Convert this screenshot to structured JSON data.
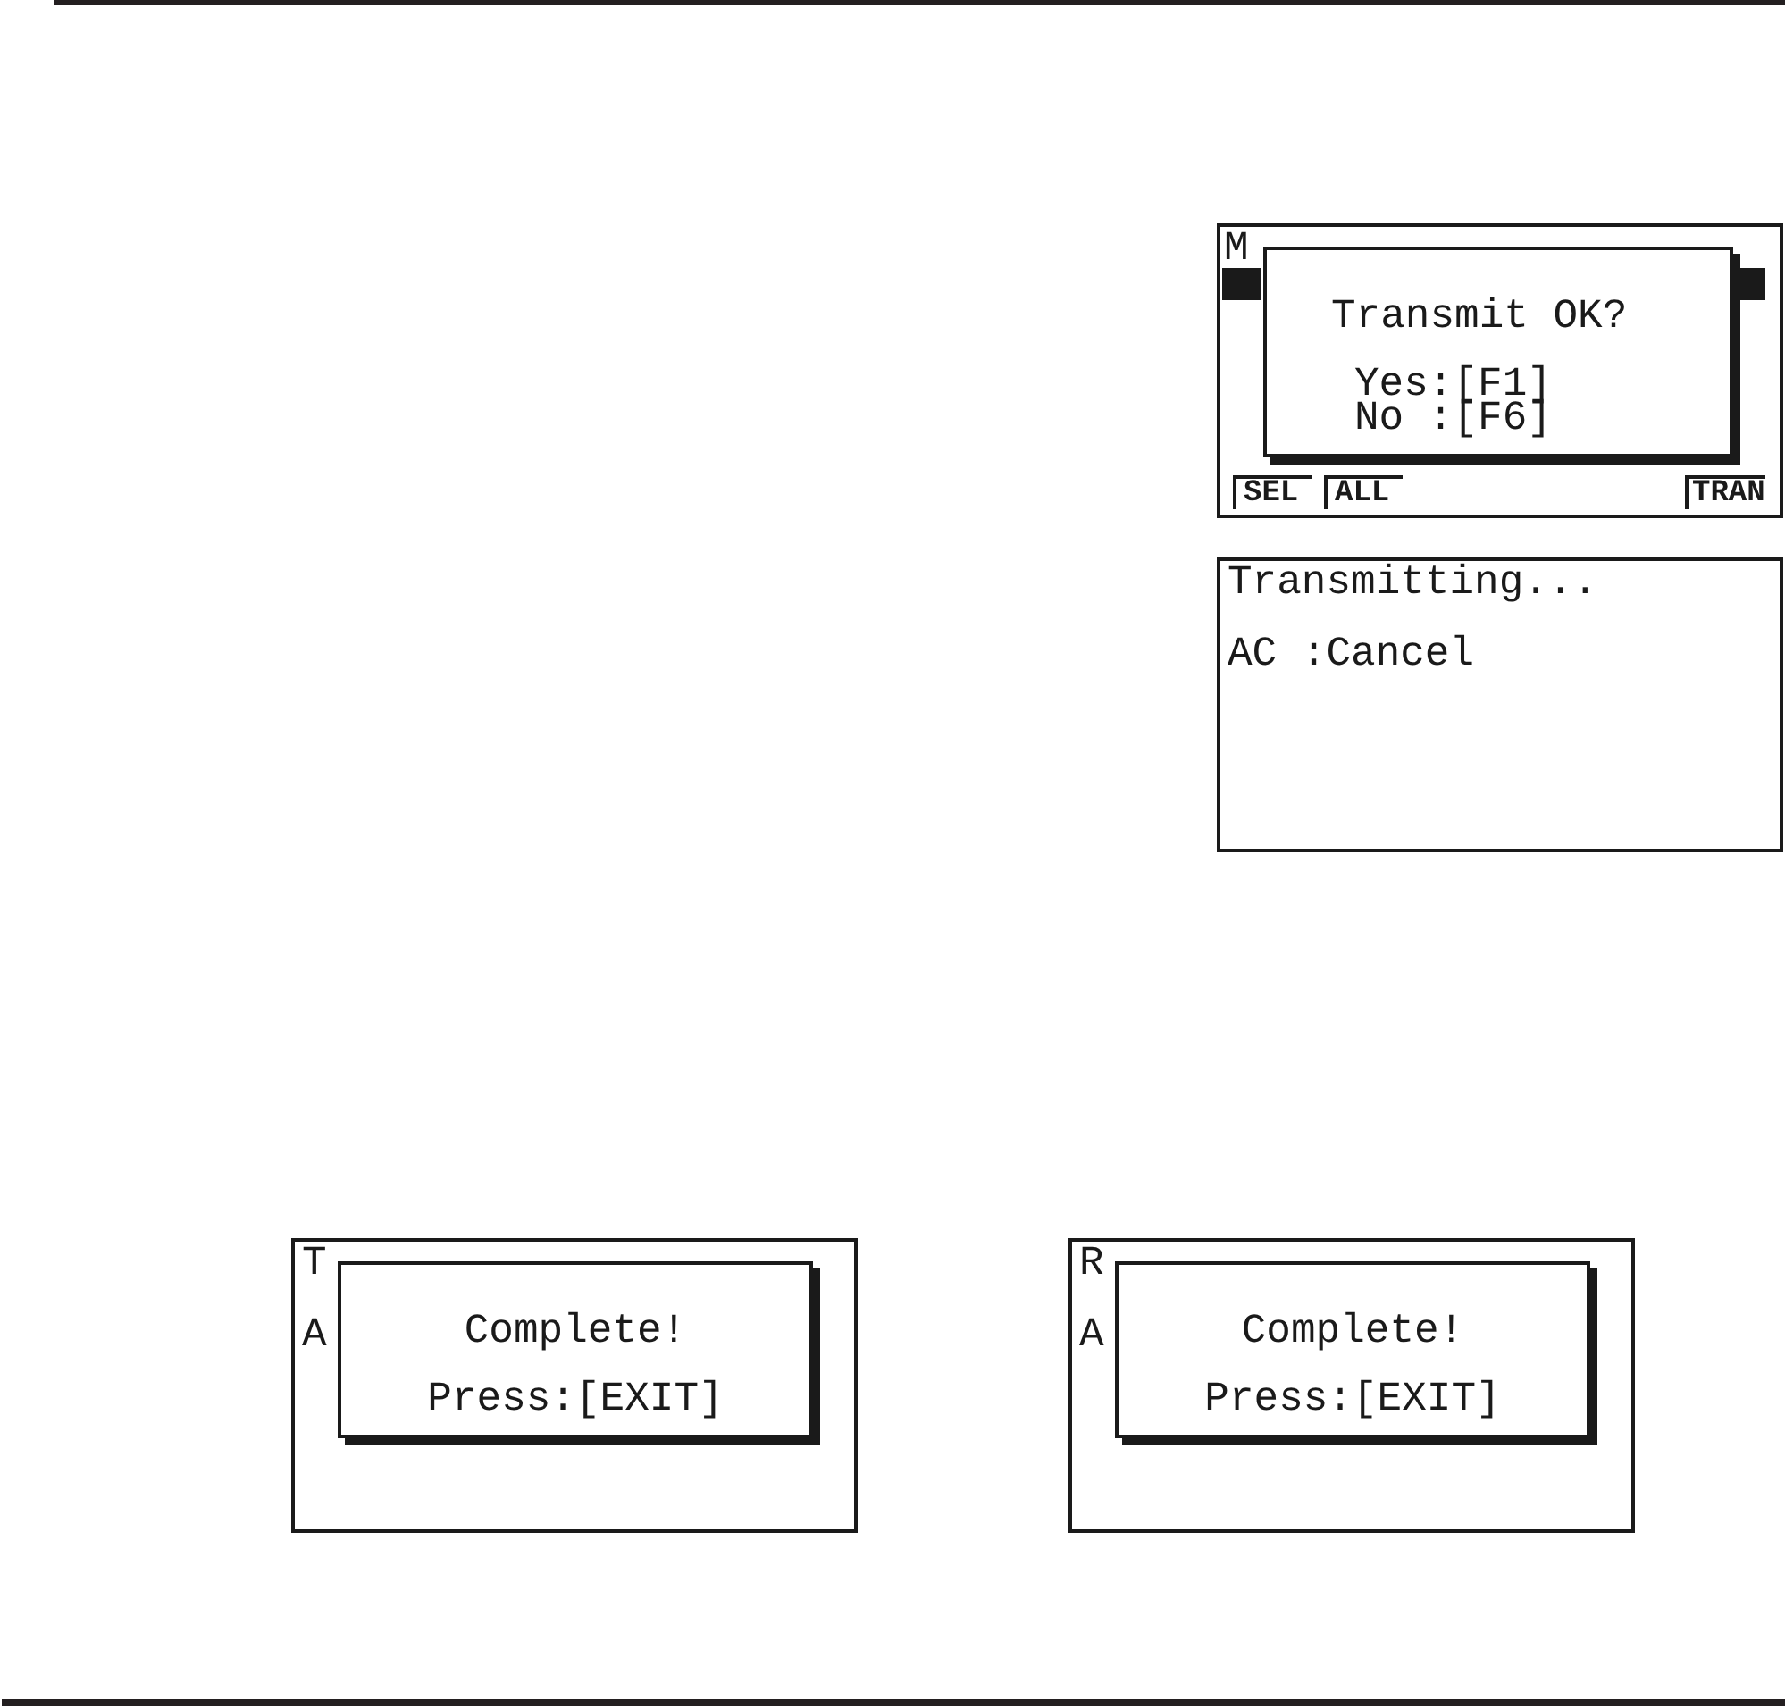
{
  "side_screens": [
    {
      "kind": "menu",
      "title": "M",
      "row_highlighted": true,
      "function_keys_left": [
        "SEL",
        "ALL"
      ],
      "function_keys_right": [
        "TRAN"
      ],
      "dialog": {
        "kind": "confirm",
        "message": "Transmit OK?",
        "options": [
          "Yes:[F1]",
          "No :[F6]"
        ]
      }
    },
    {
      "kind": "message",
      "lines": [
        "Transmitting...",
        "AC :Cancel"
      ]
    }
  ],
  "bottom_screens": [
    {
      "kind": "message",
      "lines": [
        "T",
        "A"
      ],
      "dialog": {
        "kind": "notice",
        "message": "Complete!",
        "options": [
          "Press:[EXIT]"
        ]
      }
    },
    {
      "kind": "message",
      "lines": [
        "R",
        "A"
      ],
      "dialog": {
        "kind": "notice",
        "message": "Complete!",
        "options": [
          "Press:[EXIT]"
        ]
      }
    }
  ]
}
